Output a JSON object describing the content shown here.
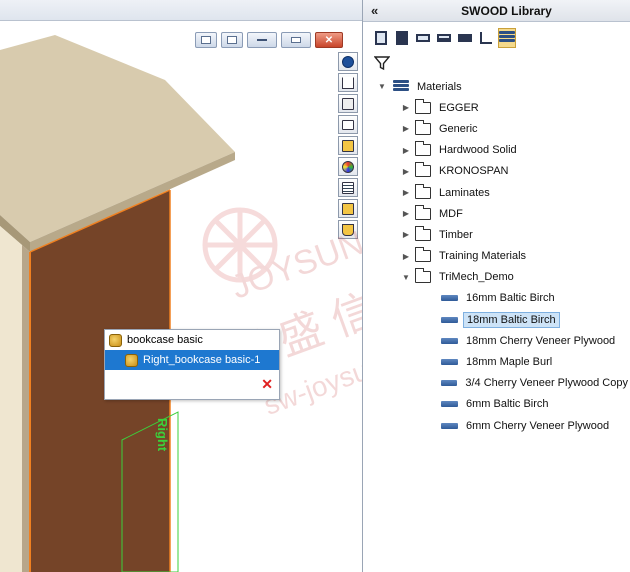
{
  "viewport": {
    "popup": {
      "title": "bookcase basic",
      "selected_item": "Right_bookcase basic-1",
      "close_glyph": "✕"
    },
    "model_label": "Right",
    "view_toolbar_icons": [
      "globe-icon",
      "home-icon",
      "cube-icon",
      "folder-icon",
      "display-icon",
      "appearance-icon",
      "list-icon",
      "library-icon",
      "properties-icon"
    ],
    "window_buttons": [
      "restore-icon",
      "tile-icon",
      "minimize-icon",
      "maximize-icon",
      "close-icon"
    ]
  },
  "panel": {
    "collapse_label": "«",
    "title": "SWOOD Library",
    "toolbar_icons": [
      "panel-icon",
      "board-icon",
      "edge-icon",
      "edge-solid-icon",
      "edge-flat-icon",
      "hardware-icon",
      "materials-icon"
    ],
    "filter_icon": "filter-icon",
    "tree": {
      "root": "Materials",
      "folders": [
        "EGGER",
        "Generic",
        "Hardwood Solid",
        "KRONOSPAN",
        "Laminates",
        "MDF",
        "Timber",
        "Training Materials"
      ],
      "open_folder": "TriMech_Demo",
      "materials": [
        "16mm Baltic Birch",
        "18mm Baltic Birch",
        "18mm Cherry Veneer Plywood",
        "18mm Maple Burl",
        "3/4  Cherry Veneer Plywood Copy",
        "6mm Baltic Birch",
        "6mm Cherry Veneer Plywood"
      ],
      "selected_material": "18mm Baltic Birch"
    }
  },
  "colors": {
    "selection": "#1e78d0",
    "tree_selection": "#cde3f7",
    "wood_top": "#d9ccb0",
    "wood_side": "#7a4a2e",
    "edge_highlight": "#f08020",
    "model_green": "#3bd03b"
  }
}
